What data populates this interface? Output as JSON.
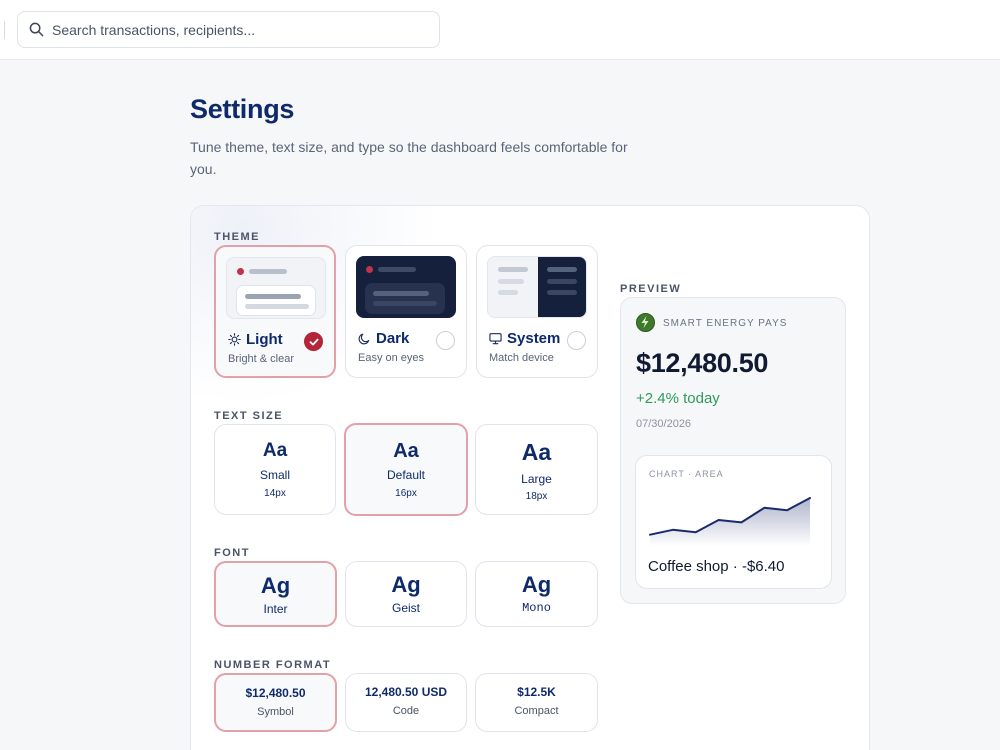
{
  "search": {
    "placeholder": "Search transactions, recipients..."
  },
  "page": {
    "title": "Settings",
    "subtitle": "Tune theme, text size, and type so the dashboard feels comfortable for you."
  },
  "sections": {
    "theme": "THEME",
    "text_size": "TEXT SIZE",
    "font": "FONT",
    "number_format": "NUMBER FORMAT",
    "preview": "PREVIEW"
  },
  "theme_options": [
    {
      "name": "Light",
      "desc": "Bright & clear",
      "icon": "sun-icon",
      "selected": true
    },
    {
      "name": "Dark",
      "desc": "Easy on eyes",
      "icon": "moon-icon",
      "selected": false
    },
    {
      "name": "System",
      "desc": "Match device",
      "icon": "monitor-icon",
      "selected": false
    }
  ],
  "text_size_options": [
    {
      "sample": "Aa",
      "name": "Small",
      "size": "14px",
      "selected": false
    },
    {
      "sample": "Aa",
      "name": "Default",
      "size": "16px",
      "selected": true
    },
    {
      "sample": "Aa",
      "name": "Large",
      "size": "18px",
      "selected": false
    }
  ],
  "font_options": [
    {
      "sample": "Ag",
      "name": "Inter",
      "selected": true
    },
    {
      "sample": "Ag",
      "name": "Geist",
      "selected": false
    },
    {
      "sample": "Ag",
      "name": "Mono",
      "selected": false
    }
  ],
  "number_format_options": [
    {
      "value": "$12,480.50",
      "name": "Symbol",
      "selected": true
    },
    {
      "value": "12,480.50 USD",
      "name": "Code",
      "selected": false
    },
    {
      "value": "$12.5K",
      "name": "Compact",
      "selected": false
    }
  ],
  "preview": {
    "brand": "SMART ENERGY PAYS",
    "amount": "$12,480.50",
    "change": "+2.4% today",
    "date": "07/30/2026",
    "chart_title": "CHART · AREA",
    "caption": "Coffee shop · -$6.40"
  },
  "chart_data": {
    "type": "area",
    "x": [
      0,
      1,
      2,
      3,
      4,
      5,
      6,
      7
    ],
    "values": [
      3,
      5,
      4,
      9,
      8,
      14,
      13,
      18
    ],
    "title": "",
    "xlabel": "",
    "ylabel": "",
    "grid": false,
    "series": [
      {
        "values": [
          3,
          5,
          4,
          9,
          8,
          14,
          13,
          18
        ]
      }
    ]
  },
  "colors": {
    "accent": "#b3263a",
    "selected_border": "#e2a0a8",
    "title": "#0f2a6b",
    "positive": "#2f9a5a",
    "chart_line": "#1b2a6b"
  }
}
